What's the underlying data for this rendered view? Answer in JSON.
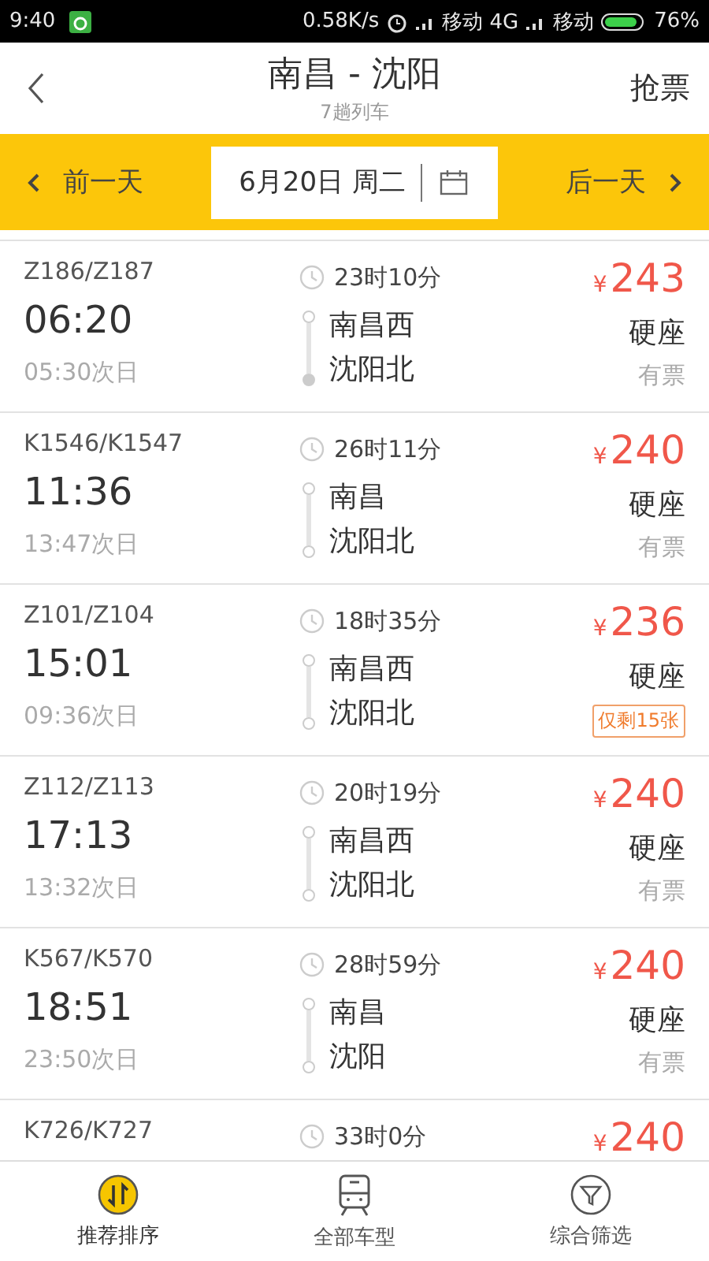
{
  "status_bar": {
    "time": "9:40",
    "speed": "0.58K/s",
    "carrier1": "移动 4G",
    "carrier2": "移动",
    "battery": "76%"
  },
  "header": {
    "title": "南昌 - 沈阳",
    "subtitle": "7趟列车",
    "action": "抢票"
  },
  "date_bar": {
    "prev": "前一天",
    "date": "6月20日 周二",
    "next": "后一天"
  },
  "trains": [
    {
      "number": "Z186/Z187",
      "depart": "06:20",
      "arrive": "05:30次日",
      "duration": "23时10分",
      "from": {
        "name": "南昌西",
        "filled": false
      },
      "to": {
        "name": "沈阳北",
        "filled": true
      },
      "currency": "¥",
      "price": "243",
      "seat": "硬座",
      "availability": {
        "kind": "plain",
        "text": "有票"
      }
    },
    {
      "number": "K1546/K1547",
      "depart": "11:36",
      "arrive": "13:47次日",
      "duration": "26时11分",
      "from": {
        "name": "南昌",
        "filled": false
      },
      "to": {
        "name": "沈阳北",
        "filled": false
      },
      "currency": "¥",
      "price": "240",
      "seat": "硬座",
      "availability": {
        "kind": "plain",
        "text": "有票"
      }
    },
    {
      "number": "Z101/Z104",
      "depart": "15:01",
      "arrive": "09:36次日",
      "duration": "18时35分",
      "from": {
        "name": "南昌西",
        "filled": false
      },
      "to": {
        "name": "沈阳北",
        "filled": false
      },
      "currency": "¥",
      "price": "236",
      "seat": "硬座",
      "availability": {
        "kind": "tag",
        "text": "仅剩15张"
      }
    },
    {
      "number": "Z112/Z113",
      "depart": "17:13",
      "arrive": "13:32次日",
      "duration": "20时19分",
      "from": {
        "name": "南昌西",
        "filled": false
      },
      "to": {
        "name": "沈阳北",
        "filled": false
      },
      "currency": "¥",
      "price": "240",
      "seat": "硬座",
      "availability": {
        "kind": "plain",
        "text": "有票"
      }
    },
    {
      "number": "K567/K570",
      "depart": "18:51",
      "arrive": "23:50次日",
      "duration": "28时59分",
      "from": {
        "name": "南昌",
        "filled": false
      },
      "to": {
        "name": "沈阳",
        "filled": false
      },
      "currency": "¥",
      "price": "240",
      "seat": "硬座",
      "availability": {
        "kind": "plain",
        "text": "有票"
      }
    },
    {
      "number": "K726/K727",
      "duration": "33时0分",
      "currency": "¥",
      "price": "240"
    }
  ],
  "bottom_nav": [
    {
      "label": "推荐排序",
      "kind": "sort",
      "selected": true
    },
    {
      "label": "全部车型",
      "kind": "train",
      "selected": false
    },
    {
      "label": "综合筛选",
      "kind": "filter",
      "selected": false
    }
  ]
}
